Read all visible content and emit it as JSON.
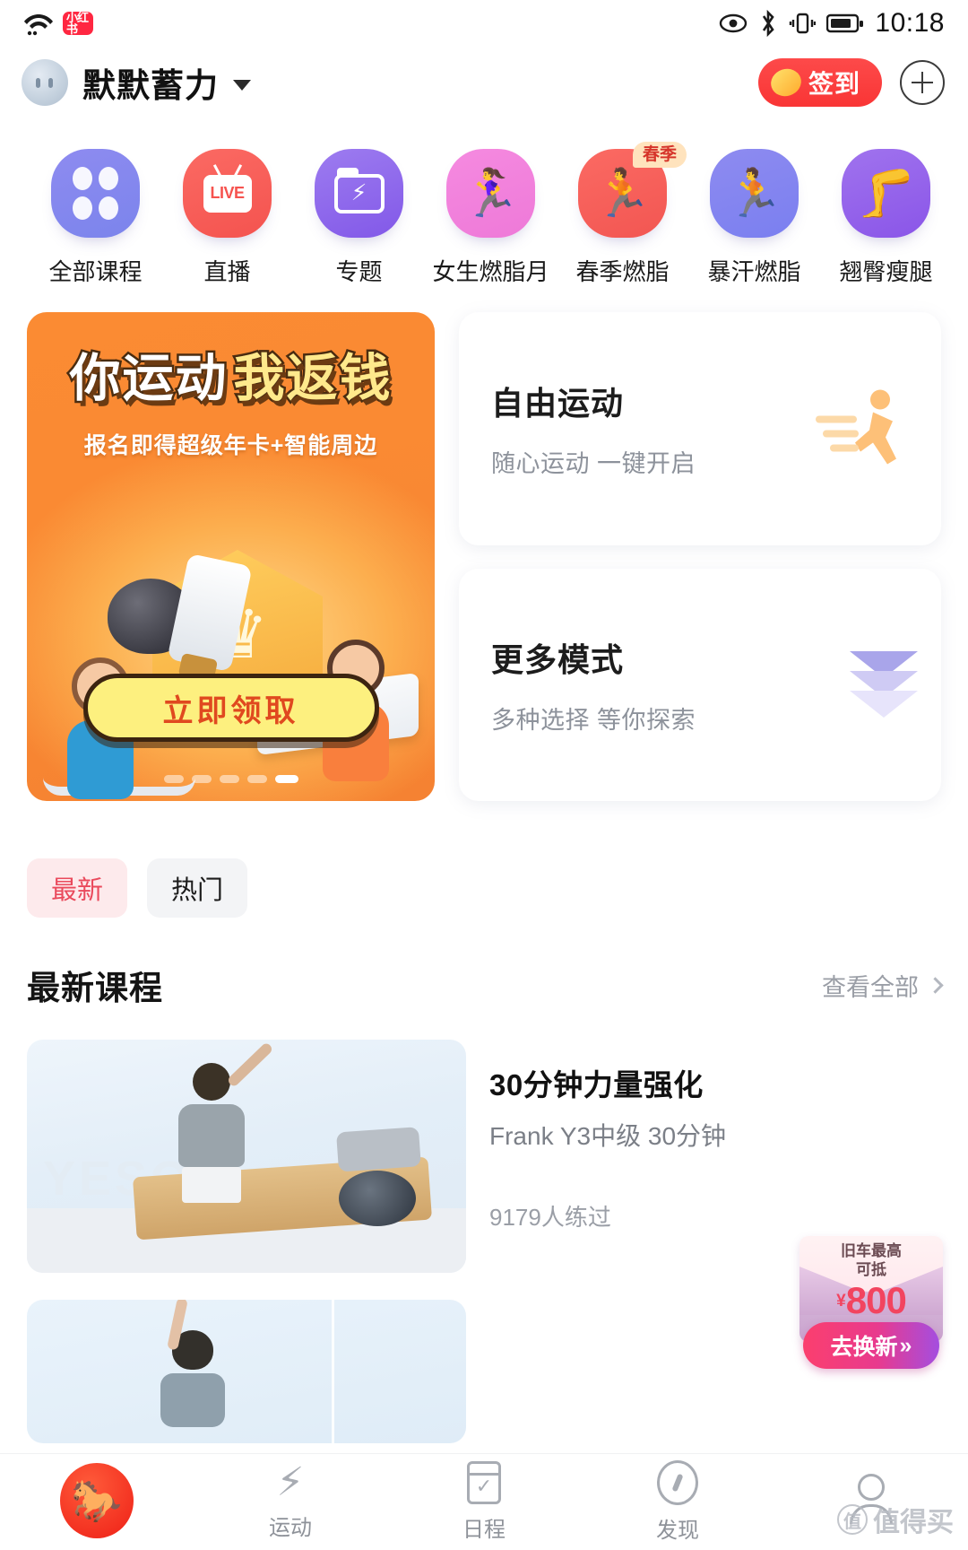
{
  "status_bar": {
    "wifi_icon": "wifi-icon",
    "app_badge": "小红书",
    "icons": [
      "eye-icon",
      "bluetooth-icon",
      "vibrate-icon",
      "battery-icon"
    ],
    "time": "10:18"
  },
  "header": {
    "avatar": "user-avatar",
    "username": "默默蓄力",
    "dropdown_icon": "chevron-down-icon",
    "signin_label": "签到",
    "signin_icon": "coin-icon",
    "add_icon": "plus-icon"
  },
  "categories": [
    {
      "label": "全部课程",
      "icon": "grid-icon",
      "badge": ""
    },
    {
      "label": "直播",
      "icon": "live-tv-icon",
      "badge": ""
    },
    {
      "label": "专题",
      "icon": "folder-bolt-icon",
      "badge": ""
    },
    {
      "label": "女生燃脂月",
      "icon": "female-figure-icon",
      "badge": ""
    },
    {
      "label": "春季燃脂",
      "icon": "runner-icon",
      "badge": "春季"
    },
    {
      "label": "暴汗燃脂",
      "icon": "sweat-runner-icon",
      "badge": ""
    },
    {
      "label": "翘臀瘦腿",
      "icon": "glutes-icon",
      "badge": ""
    }
  ],
  "banner": {
    "title_white": "你运动",
    "title_yellow": "我返钱",
    "subtitle": "报名即得超级年卡+智能周边",
    "cta_label": "立即领取",
    "dots_total": 5,
    "dots_active": 5
  },
  "mode_cards": [
    {
      "title": "自由运动",
      "subtitle": "随心运动 一键开启",
      "art_icon": "running-person-icon"
    },
    {
      "title": "更多模式",
      "subtitle": "多种选择 等你探索",
      "art_icon": "chevron-double-down-icon"
    }
  ],
  "filters": [
    {
      "label": "最新",
      "active": true
    },
    {
      "label": "热门",
      "active": false
    }
  ],
  "section": {
    "title": "最新课程",
    "more_label": "查看全部",
    "more_icon": "chevron-right-icon"
  },
  "courses": [
    {
      "title": "30分钟力量强化",
      "subtitle": "Frank Y3中级 30分钟",
      "count": "9179人练过",
      "thumb_watermark": "YESOUL"
    },
    {
      "title": "",
      "subtitle": "",
      "count": "",
      "thumb_watermark": ""
    }
  ],
  "float_ad": {
    "line1": "旧车最高",
    "line2": "可抵",
    "currency": "¥",
    "amount": "800",
    "button_label": "去换新",
    "button_arrow": "»"
  },
  "bottom_nav": [
    {
      "label": "",
      "icon": "brand-horse-logo-icon",
      "active": true
    },
    {
      "label": "运动",
      "icon": "bolt-icon",
      "active": false
    },
    {
      "label": "日程",
      "icon": "calendar-check-icon",
      "active": false
    },
    {
      "label": "发现",
      "icon": "compass-icon",
      "active": false
    },
    {
      "label": "",
      "icon": "profile-icon",
      "active": false
    }
  ],
  "watermark": {
    "text": "值得买",
    "icon": "zhi-circle-icon"
  },
  "colors": {
    "accent_red": "#ea4a5c",
    "signin_red": "#f93535",
    "banner_orange": "#fa8a33",
    "cta_yellow": "#fdf07f",
    "ad_pink": "#f2445f"
  }
}
